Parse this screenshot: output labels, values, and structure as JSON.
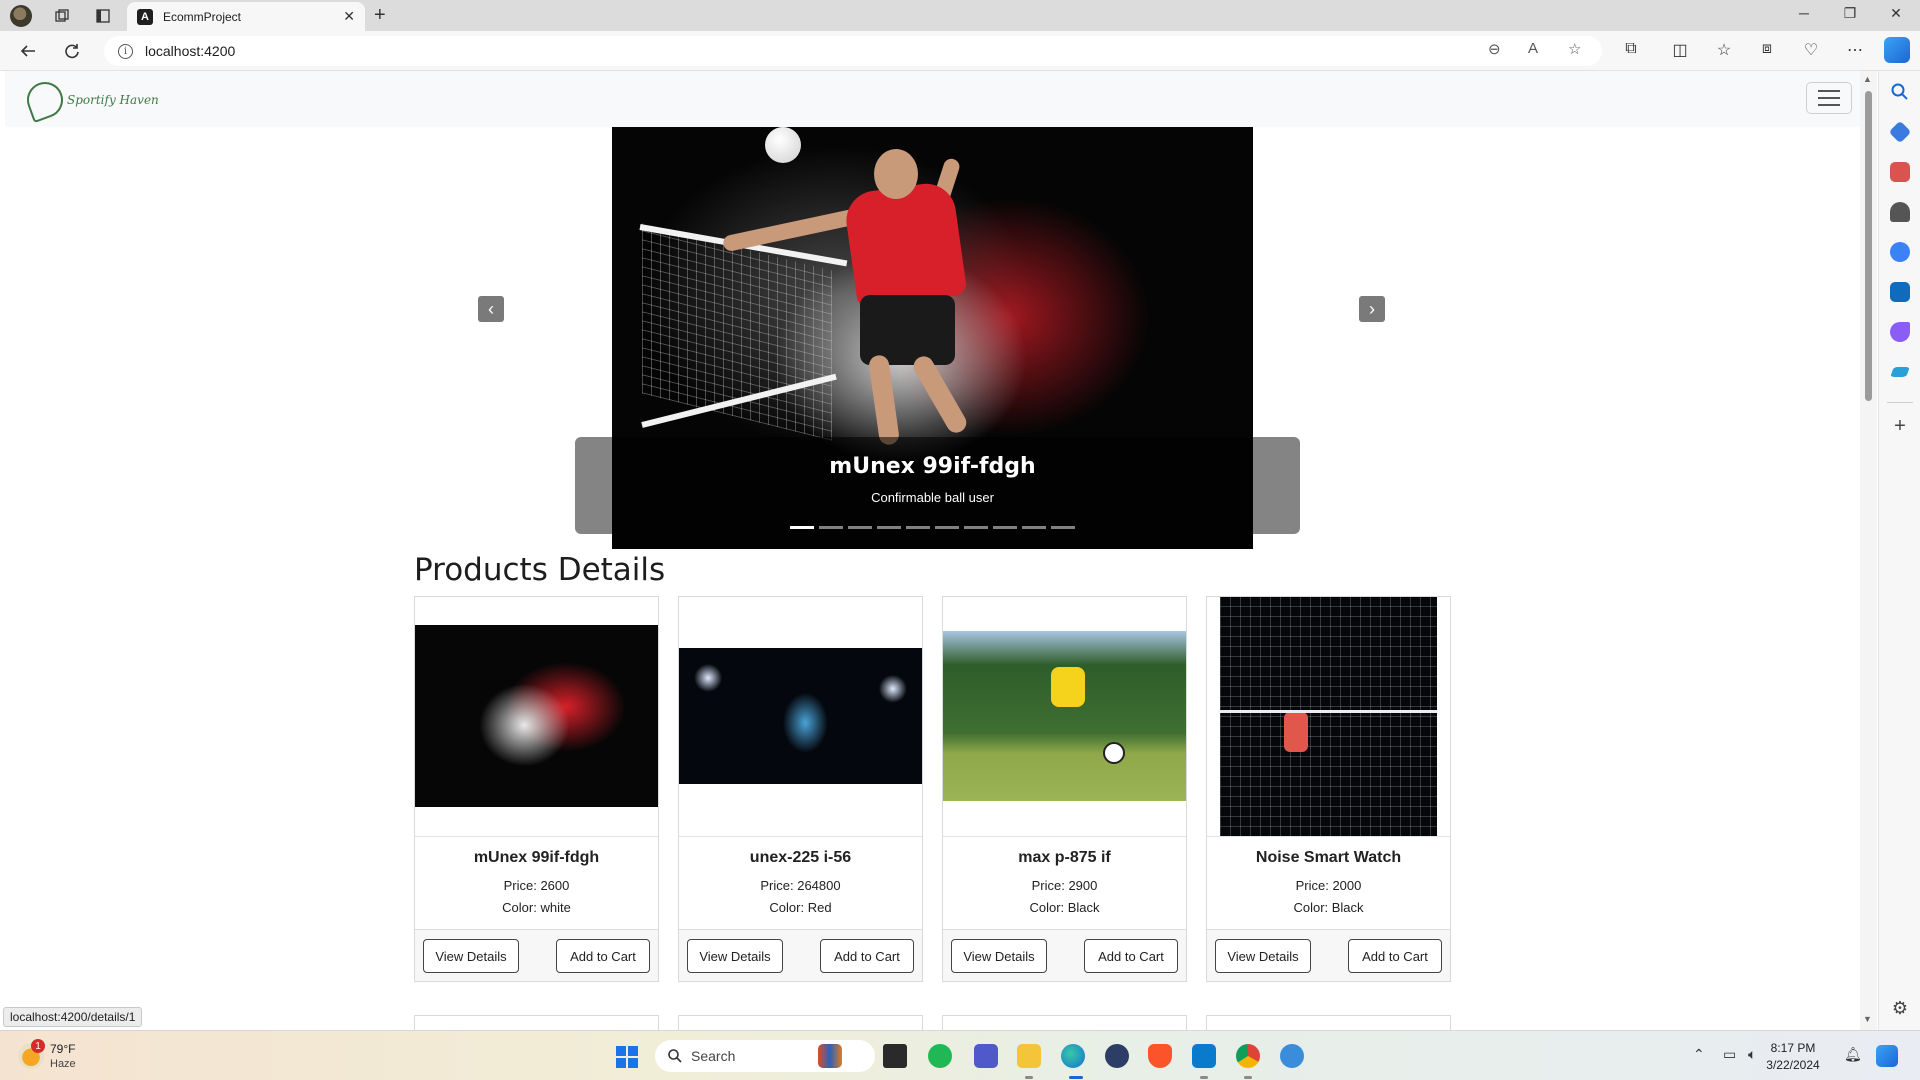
{
  "browser": {
    "tab_title": "EcommProject",
    "tab_favicon_letter": "A",
    "url": "localhost:4200",
    "status_url": "localhost:4200/details/1"
  },
  "site": {
    "logo_text": "Sportify Haven"
  },
  "carousel": {
    "caption_title": "mUnex 99if-fdgh",
    "caption_text": "Confirmable ball user",
    "slide_count": 10,
    "active_index": 0
  },
  "section_title": "Products Details",
  "products": [
    {
      "name": "mUnex 99if-fdgh",
      "price": "Price: 2600",
      "color": "Color: white",
      "view_label": "View Details",
      "cart_label": "Add to Cart"
    },
    {
      "name": "unex-225 i-56",
      "price": "Price: 264800",
      "color": "Color: Red",
      "view_label": "View Details",
      "cart_label": "Add to Cart"
    },
    {
      "name": "max p-875 if",
      "price": "Price: 2900",
      "color": "Color: Black",
      "view_label": "View Details",
      "cart_label": "Add to Cart"
    },
    {
      "name": "Noise Smart Watch",
      "price": "Price: 2000",
      "color": "Color: Black",
      "view_label": "View Details",
      "cart_label": "Add to Cart"
    }
  ],
  "taskbar": {
    "weather_temp": "79°F",
    "weather_condition": "Haze",
    "weather_badge": "1",
    "search_label": "Search",
    "time": "8:17 PM",
    "date": "3/22/2024"
  },
  "icons": {
    "back": "back-arrow-icon",
    "refresh": "refresh-icon",
    "menu": "hamburger-menu-icon",
    "prev": "chevron-left-icon",
    "next": "chevron-right-icon"
  }
}
